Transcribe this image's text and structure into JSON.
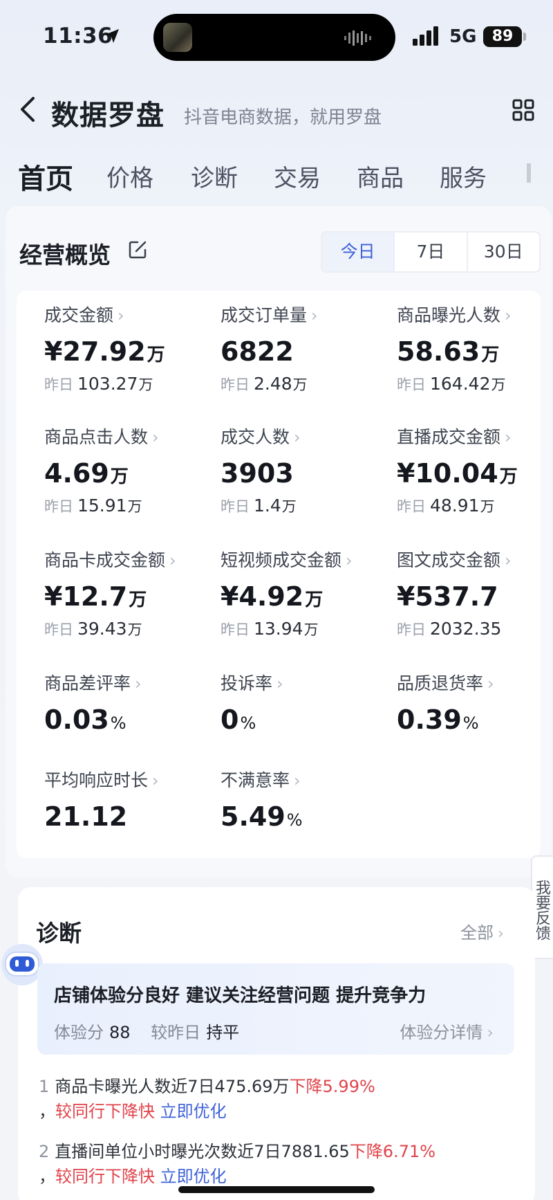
{
  "status": {
    "time": "11:36",
    "network": "5G",
    "battery": "89"
  },
  "nav": {
    "title": "数据罗盘",
    "subtitle": "抖音电商数据，就用罗盘"
  },
  "tabs": [
    "首页",
    "价格",
    "诊断",
    "交易",
    "商品",
    "服务"
  ],
  "overview": {
    "title": "经营概览",
    "ranges": [
      "今日",
      "7日",
      "30日"
    ],
    "yesterday_label": "昨日",
    "metrics": [
      {
        "label": "成交金额",
        "prefix": "¥",
        "value": "27.92",
        "unit": "万",
        "y_value": "103.27",
        "y_unit": "万"
      },
      {
        "label": "成交订单量",
        "prefix": "",
        "value": "6822",
        "unit": "",
        "y_value": "2.48",
        "y_unit": "万"
      },
      {
        "label": "商品曝光人数",
        "prefix": "",
        "value": "58.63",
        "unit": "万",
        "y_value": "164.42",
        "y_unit": "万"
      },
      {
        "label": "商品点击人数",
        "prefix": "",
        "value": "4.69",
        "unit": "万",
        "y_value": "15.91",
        "y_unit": "万"
      },
      {
        "label": "成交人数",
        "prefix": "",
        "value": "3903",
        "unit": "",
        "y_value": "1.4",
        "y_unit": "万"
      },
      {
        "label": "直播成交金额",
        "prefix": "¥",
        "value": "10.04",
        "unit": "万",
        "y_value": "48.91",
        "y_unit": "万"
      },
      {
        "label": "商品卡成交金额",
        "prefix": "¥",
        "value": "12.7",
        "unit": "万",
        "y_value": "39.43",
        "y_unit": "万"
      },
      {
        "label": "短视频成交金额",
        "prefix": "¥",
        "value": "4.92",
        "unit": "万",
        "y_value": "13.94",
        "y_unit": "万"
      },
      {
        "label": "图文成交金额",
        "prefix": "¥",
        "value": "537.7",
        "unit": "",
        "y_value": "2032.35",
        "y_unit": ""
      },
      {
        "label": "商品差评率",
        "value": "0.03",
        "pct": "%"
      },
      {
        "label": "投诉率",
        "value": "0",
        "pct": "%"
      },
      {
        "label": "品质退货率",
        "value": "0.39",
        "pct": "%"
      },
      {
        "label": "平均响应时长",
        "value": "21.12",
        "pct": ""
      },
      {
        "label": "不满意率",
        "value": "5.49",
        "pct": "%"
      }
    ]
  },
  "feedback": "我要反馈",
  "diagnosis": {
    "title": "诊断",
    "all_label": "全部",
    "headline": "店铺体验分良好 建议关注经营问题 提升竞争力",
    "score_label": "体验分",
    "score": "88",
    "compare_label": "较昨日",
    "compare_value": "持平",
    "detail_link": "体验分详情",
    "issues": [
      {
        "num": "1",
        "text": "商品卡曝光人数近7日475.69万",
        "trend": "下降5.99%",
        "comma": "，",
        "note": "较同行下降快",
        "action": "立即优化"
      },
      {
        "num": "2",
        "text": "直播间单位小时曝光次数近7日7881.65",
        "trend": "下降6.71%",
        "comma": "，",
        "note": "较同行下降快",
        "action": "立即优化"
      }
    ]
  }
}
